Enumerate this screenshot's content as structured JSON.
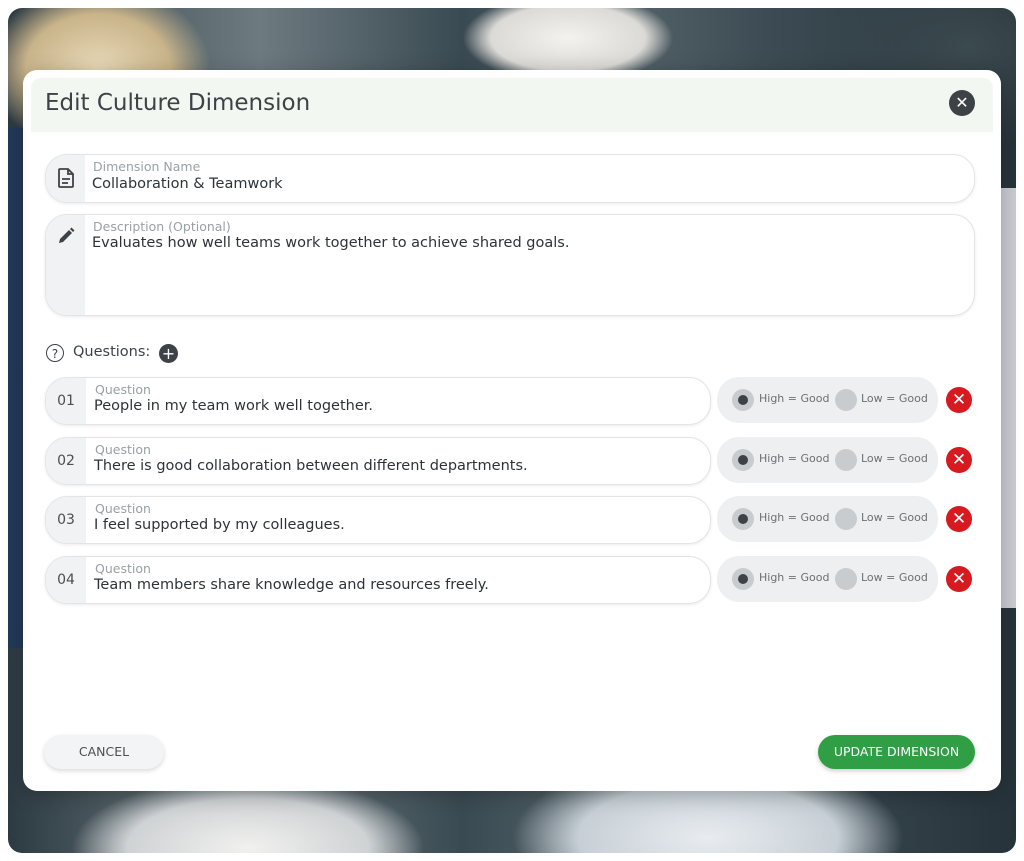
{
  "modal": {
    "title": "Edit Culture Dimension"
  },
  "dimension_name": {
    "label": "Dimension Name",
    "value": "Collaboration & Teamwork",
    "icon": "document-icon"
  },
  "description": {
    "label": "Description (Optional)",
    "value": "Evaluates how well teams work together to achieve shared goals.",
    "icon": "pencil-icon"
  },
  "questions": {
    "heading": "Questions:",
    "field_label": "Question",
    "option_high": "High = Good",
    "option_low": "Low = Good",
    "items": [
      {
        "num": "01",
        "text": "People in my team work well together.",
        "selected": "high"
      },
      {
        "num": "02",
        "text": "There is good collaboration between different departments.",
        "selected": "high"
      },
      {
        "num": "03",
        "text": "I feel supported by my colleagues.",
        "selected": "high"
      },
      {
        "num": "04",
        "text": "Team members share knowledge and resources freely.",
        "selected": "high"
      }
    ]
  },
  "buttons": {
    "cancel": "CANCEL",
    "update": "UPDATE DIMENSION"
  },
  "colors": {
    "accent_green": "#2f9e44",
    "delete_red": "#d71920",
    "header_bg": "#f3f7f1"
  }
}
